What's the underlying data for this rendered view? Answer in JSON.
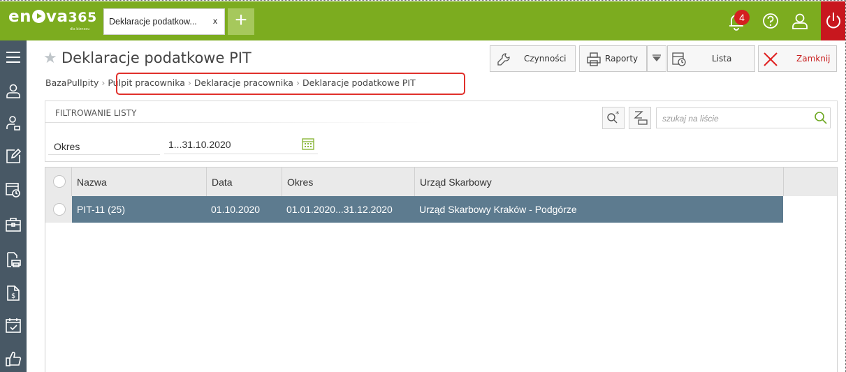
{
  "app": {
    "logo_text": "enova365",
    "logo_sub": "dla biznesu",
    "tab_label": "Deklaracje podatkow...",
    "tab_close": "x",
    "new_tab": "+",
    "notifications_count": "4"
  },
  "header": {
    "title": "Deklaracje podatkowe PIT",
    "toolbar": {
      "czynnosci": "Czynności",
      "raporty": "Raporty",
      "lista": "Lista",
      "zamknij": "Zamknij"
    }
  },
  "breadcrumb": [
    "BazaPullpity",
    "Pulpit pracownika",
    "Deklaracje pracownika",
    "Deklaracje podatkowe PIT"
  ],
  "filter": {
    "title": "FILTROWANIE LISTY",
    "okres_label": "Okres",
    "okres_value": "1...31.10.2020",
    "search_placeholder": "szukaj na liście"
  },
  "grid": {
    "columns": [
      "Nazwa",
      "Data",
      "Okres",
      "Urząd Skarbowy"
    ],
    "rows": [
      {
        "nazwa": "PIT-11 (25)",
        "data": "01.10.2020",
        "okres": "01.01.2020...31.12.2020",
        "urzad": "Urząd Skarbowy Kraków - Podgórze"
      }
    ]
  },
  "colors": {
    "brand_green": "#7cac1f",
    "sidebar": "#485865",
    "selected_row": "#5d7b8f",
    "power_red": "#c8171e",
    "highlight": "#e0302b"
  },
  "icons": {
    "sidebar": [
      "menu-icon",
      "person-icon",
      "people-icon",
      "edit-icon",
      "calendar-clock-icon",
      "briefcase-icon",
      "document-printer-icon",
      "money-document-icon",
      "calendar-check-icon",
      "thumbs-up-icon"
    ],
    "top": [
      "bell-icon",
      "help-icon",
      "user-icon",
      "power-icon"
    ]
  }
}
